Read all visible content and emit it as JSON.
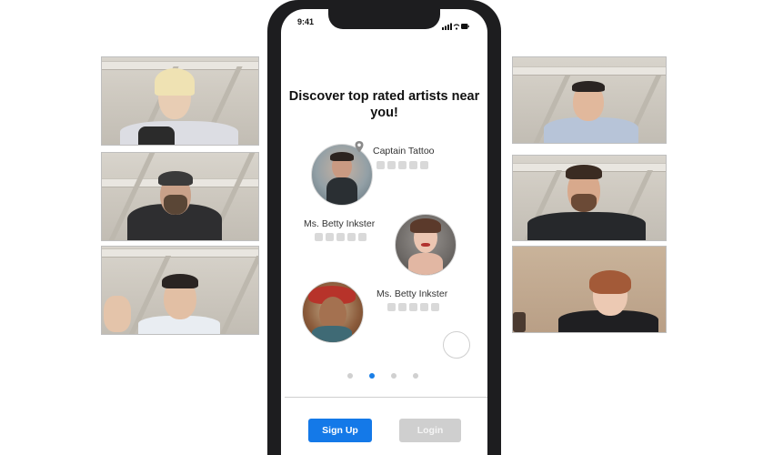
{
  "app": {
    "status_time": "9:41",
    "headline": "Discover top rated artists near you!",
    "artists": [
      {
        "name": "Captain Tattoo"
      },
      {
        "name": "Ms. Betty Inkster"
      },
      {
        "name": "Ms. Betty Inkster"
      }
    ],
    "carousel_active_index": 1,
    "carousel_count": 4,
    "buttons": {
      "signup": "Sign Up",
      "login": "Login"
    }
  },
  "video_participants": {
    "left_count": 3,
    "right_count": 3
  },
  "colors": {
    "primary": "#1479e8",
    "disabled": "#cfcfcf",
    "phone_frame": "#1d1d1f"
  },
  "icons": [
    "location-pin-icon",
    "signal-icon",
    "wifi-icon",
    "battery-icon"
  ]
}
